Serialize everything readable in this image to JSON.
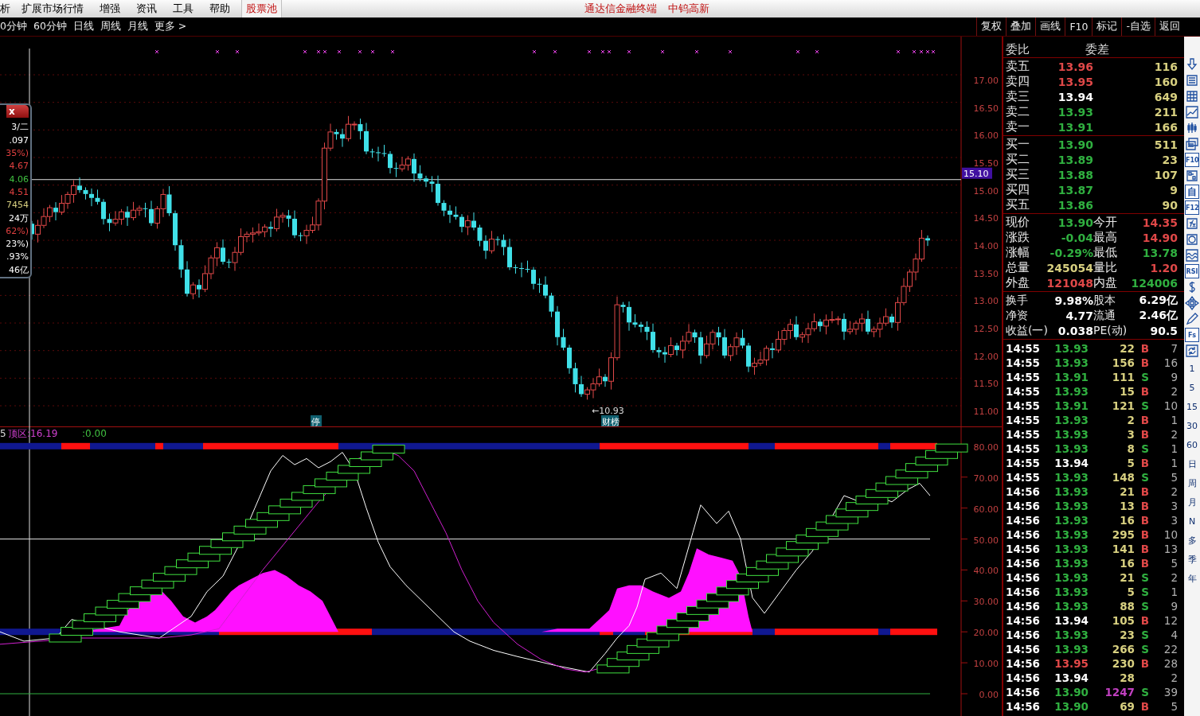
{
  "menu": [
    {
      "label": "析",
      "selected": false
    },
    {
      "label": "扩展市场行情",
      "selected": false
    },
    {
      "label": "增强",
      "selected": false
    },
    {
      "label": "资讯",
      "selected": false
    },
    {
      "label": "工具",
      "selected": false
    },
    {
      "label": "帮助",
      "selected": false
    },
    {
      "label": "股票池",
      "selected": true
    }
  ],
  "title": {
    "app": "通达信金融终端",
    "stock": "中钨高新"
  },
  "periods": [
    "0分钟",
    "60分钟",
    "日线",
    "周线",
    "月线",
    "更多 >"
  ],
  "chart_tools": [
    "复权",
    "叠加",
    "画线",
    "F10",
    "标记",
    "-自选",
    "返回"
  ],
  "info_popup": {
    "close": "x",
    "lines": [
      {
        "text": "3/二",
        "color": "#ffffff"
      },
      {
        "text": ".097",
        "color": "#ffffff"
      },
      {
        "text": "35%)",
        "color": "#e04040"
      },
      {
        "text": "4.67",
        "color": "#e04040"
      },
      {
        "text": "4.06",
        "color": "#40c040"
      },
      {
        "text": "4.51",
        "color": "#e04040"
      },
      {
        "text": "7454",
        "color": "#d8d080"
      },
      {
        "text": "24万",
        "color": "#ffffff"
      },
      {
        "text": "62%)",
        "color": "#e04040"
      },
      {
        "text": "23%)",
        "color": "#ffffff"
      },
      {
        "text": ".93%",
        "color": "#ffffff"
      },
      {
        "text": "46亿",
        "color": "#ffffff"
      }
    ]
  },
  "price_chart": {
    "axis": [
      "17.00",
      "16.50",
      "16.00",
      "15.50",
      "15.00",
      "14.50",
      "14.00",
      "13.50",
      "13.00",
      "12.50",
      "12.00",
      "11.50",
      "11.00"
    ],
    "price_tag": "15.10",
    "low_label": "←10.93",
    "markers": [
      "停",
      "财榜"
    ]
  },
  "indicator": {
    "prefix": "5",
    "label": "顶区:16.19",
    "value": ":0.00",
    "axis": [
      "80.00",
      "70.00",
      "60.00",
      "50.00",
      "40.00",
      "30.00",
      "20.00",
      "10.00",
      "0.00"
    ]
  },
  "order_book": {
    "header": [
      "委比",
      "委差"
    ],
    "asks": [
      {
        "label": "卖五",
        "price": "13.96",
        "volume": "116",
        "color": "#e04848"
      },
      {
        "label": "卖四",
        "price": "13.95",
        "volume": "160",
        "color": "#e04848"
      },
      {
        "label": "卖三",
        "price": "13.94",
        "volume": "649",
        "color": "#ffffff"
      },
      {
        "label": "卖二",
        "price": "13.93",
        "volume": "211",
        "color": "#30b040"
      },
      {
        "label": "卖一",
        "price": "13.91",
        "volume": "166",
        "color": "#30b040"
      }
    ],
    "bids": [
      {
        "label": "买一",
        "price": "13.90",
        "volume": "511",
        "color": "#30b040"
      },
      {
        "label": "买二",
        "price": "13.89",
        "volume": "23",
        "color": "#30b040"
      },
      {
        "label": "买三",
        "price": "13.88",
        "volume": "107",
        "color": "#30b040"
      },
      {
        "label": "买四",
        "price": "13.87",
        "volume": "9",
        "color": "#30b040"
      },
      {
        "label": "买五",
        "price": "13.86",
        "volume": "90",
        "color": "#30b040"
      }
    ],
    "quote": [
      {
        "label": "现价",
        "value": {
          "text": "13.90",
          "color": "#30b040"
        },
        "label2": "今开",
        "value2": {
          "text": "14.35",
          "color": "#e04848"
        }
      },
      {
        "label": "涨跌",
        "value": {
          "text": "-0.04",
          "color": "#30b040"
        },
        "label2": "最高",
        "value2": {
          "text": "14.90",
          "color": "#e04848"
        }
      },
      {
        "label": "涨幅",
        "value": {
          "text": "-0.29%",
          "color": "#30b040"
        },
        "label2": "最低",
        "value2": {
          "text": "13.78",
          "color": "#30b040"
        }
      },
      {
        "label": "总量",
        "value": {
          "text": "245054",
          "color": "#d8d080"
        },
        "label2": "量比",
        "value2": {
          "text": "1.20",
          "color": "#e04848"
        }
      },
      {
        "label": "外盘",
        "value": {
          "text": "121048",
          "color": "#e04848"
        },
        "label2": "内盘",
        "value2": {
          "text": "124006",
          "color": "#30b040"
        }
      }
    ],
    "finance": [
      {
        "label": "换手",
        "value": "9.98%",
        "label2": "股本",
        "value2": "6.29亿"
      },
      {
        "label": "净资",
        "value": "4.77",
        "label2": "流通",
        "value2": "2.46亿"
      },
      {
        "label": "收益(一)",
        "value": "0.038",
        "label2": "PE(动)",
        "value2": "90.5"
      }
    ]
  },
  "trades": [
    {
      "time": "14:55",
      "price": {
        "text": "13.93",
        "color": "#30b040"
      },
      "volume": {
        "text": "22",
        "color": "#d8d080"
      },
      "side": {
        "text": "B",
        "color": "#e04848"
      },
      "count": "7"
    },
    {
      "time": "14:55",
      "price": {
        "text": "13.93",
        "color": "#30b040"
      },
      "volume": {
        "text": "156",
        "color": "#d8d080"
      },
      "side": {
        "text": "B",
        "color": "#e04848"
      },
      "count": "16"
    },
    {
      "time": "14:55",
      "price": {
        "text": "13.91",
        "color": "#30b040"
      },
      "volume": {
        "text": "111",
        "color": "#d8d080"
      },
      "side": {
        "text": "S",
        "color": "#30b040"
      },
      "count": "9"
    },
    {
      "time": "14:55",
      "price": {
        "text": "13.93",
        "color": "#30b040"
      },
      "volume": {
        "text": "15",
        "color": "#d8d080"
      },
      "side": {
        "text": "B",
        "color": "#e04848"
      },
      "count": "2"
    },
    {
      "time": "14:55",
      "price": {
        "text": "13.91",
        "color": "#30b040"
      },
      "volume": {
        "text": "121",
        "color": "#d8d080"
      },
      "side": {
        "text": "S",
        "color": "#30b040"
      },
      "count": "10"
    },
    {
      "time": "14:55",
      "price": {
        "text": "13.93",
        "color": "#30b040"
      },
      "volume": {
        "text": "2",
        "color": "#d8d080"
      },
      "side": {
        "text": "B",
        "color": "#e04848"
      },
      "count": "1"
    },
    {
      "time": "14:55",
      "price": {
        "text": "13.93",
        "color": "#30b040"
      },
      "volume": {
        "text": "3",
        "color": "#d8d080"
      },
      "side": {
        "text": "B",
        "color": "#e04848"
      },
      "count": "2"
    },
    {
      "time": "14:55",
      "price": {
        "text": "13.93",
        "color": "#30b040"
      },
      "volume": {
        "text": "8",
        "color": "#d8d080"
      },
      "side": {
        "text": "S",
        "color": "#30b040"
      },
      "count": "1"
    },
    {
      "time": "14:55",
      "price": {
        "text": "13.94",
        "color": "#ffffff"
      },
      "volume": {
        "text": "5",
        "color": "#d8d080"
      },
      "side": {
        "text": "B",
        "color": "#e04848"
      },
      "count": "1"
    },
    {
      "time": "14:55",
      "price": {
        "text": "13.93",
        "color": "#30b040"
      },
      "volume": {
        "text": "148",
        "color": "#d8d080"
      },
      "side": {
        "text": "S",
        "color": "#30b040"
      },
      "count": "5"
    },
    {
      "time": "14:56",
      "price": {
        "text": "13.93",
        "color": "#30b040"
      },
      "volume": {
        "text": "21",
        "color": "#d8d080"
      },
      "side": {
        "text": "B",
        "color": "#e04848"
      },
      "count": "2"
    },
    {
      "time": "14:56",
      "price": {
        "text": "13.93",
        "color": "#30b040"
      },
      "volume": {
        "text": "13",
        "color": "#d8d080"
      },
      "side": {
        "text": "B",
        "color": "#e04848"
      },
      "count": "3"
    },
    {
      "time": "14:56",
      "price": {
        "text": "13.93",
        "color": "#30b040"
      },
      "volume": {
        "text": "16",
        "color": "#d8d080"
      },
      "side": {
        "text": "B",
        "color": "#e04848"
      },
      "count": "3"
    },
    {
      "time": "14:56",
      "price": {
        "text": "13.93",
        "color": "#30b040"
      },
      "volume": {
        "text": "295",
        "color": "#d8d080"
      },
      "side": {
        "text": "B",
        "color": "#e04848"
      },
      "count": "10"
    },
    {
      "time": "14:56",
      "price": {
        "text": "13.93",
        "color": "#30b040"
      },
      "volume": {
        "text": "141",
        "color": "#d8d080"
      },
      "side": {
        "text": "B",
        "color": "#e04848"
      },
      "count": "13"
    },
    {
      "time": "14:56",
      "price": {
        "text": "13.93",
        "color": "#30b040"
      },
      "volume": {
        "text": "16",
        "color": "#d8d080"
      },
      "side": {
        "text": "B",
        "color": "#e04848"
      },
      "count": "5"
    },
    {
      "time": "14:56",
      "price": {
        "text": "13.93",
        "color": "#30b040"
      },
      "volume": {
        "text": "21",
        "color": "#d8d080"
      },
      "side": {
        "text": "S",
        "color": "#30b040"
      },
      "count": "2"
    },
    {
      "time": "14:56",
      "price": {
        "text": "13.93",
        "color": "#30b040"
      },
      "volume": {
        "text": "5",
        "color": "#d8d080"
      },
      "side": {
        "text": "S",
        "color": "#30b040"
      },
      "count": "1"
    },
    {
      "time": "14:56",
      "price": {
        "text": "13.93",
        "color": "#30b040"
      },
      "volume": {
        "text": "88",
        "color": "#d8d080"
      },
      "side": {
        "text": "S",
        "color": "#30b040"
      },
      "count": "9"
    },
    {
      "time": "14:56",
      "price": {
        "text": "13.94",
        "color": "#ffffff"
      },
      "volume": {
        "text": "105",
        "color": "#d8d080"
      },
      "side": {
        "text": "B",
        "color": "#e04848"
      },
      "count": "12"
    },
    {
      "time": "14:56",
      "price": {
        "text": "13.93",
        "color": "#30b040"
      },
      "volume": {
        "text": "23",
        "color": "#d8d080"
      },
      "side": {
        "text": "S",
        "color": "#30b040"
      },
      "count": "4"
    },
    {
      "time": "14:56",
      "price": {
        "text": "13.93",
        "color": "#30b040"
      },
      "volume": {
        "text": "266",
        "color": "#d8d080"
      },
      "side": {
        "text": "S",
        "color": "#30b040"
      },
      "count": "22"
    },
    {
      "time": "14:56",
      "price": {
        "text": "13.95",
        "color": "#e04848"
      },
      "volume": {
        "text": "230",
        "color": "#d8d080"
      },
      "side": {
        "text": "B",
        "color": "#e04848"
      },
      "count": "28"
    },
    {
      "time": "14:56",
      "price": {
        "text": "13.94",
        "color": "#ffffff"
      },
      "volume": {
        "text": "28",
        "color": "#d8d080"
      },
      "count": "2"
    },
    {
      "time": "14:56",
      "price": {
        "text": "13.90",
        "color": "#30b040"
      },
      "volume": {
        "text": "1247",
        "color": "#c040c0"
      },
      "side": {
        "text": "S",
        "color": "#30b040"
      },
      "count": "39"
    },
    {
      "time": "14:56",
      "price": {
        "text": "13.90",
        "color": "#30b040"
      },
      "volume": {
        "text": "69",
        "color": "#d8d080"
      },
      "side": {
        "text": "B",
        "color": "#e04848"
      },
      "count": "5"
    }
  ],
  "side_toolbar": [
    {
      "kind": "arrow-down"
    },
    {
      "kind": "list"
    },
    {
      "kind": "table"
    },
    {
      "kind": "line-chart"
    },
    {
      "kind": "candles"
    },
    {
      "kind": "windows"
    },
    {
      "kind": "text",
      "label": "F10"
    },
    {
      "kind": "tree"
    },
    {
      "kind": "text",
      "label": "自"
    },
    {
      "kind": "text",
      "label": "F12"
    },
    {
      "kind": "fx"
    },
    {
      "kind": "circle"
    },
    {
      "kind": "wave"
    },
    {
      "kind": "text",
      "label": "RSI"
    },
    {
      "kind": "dollar"
    },
    {
      "kind": "move"
    },
    {
      "kind": "pencil"
    },
    {
      "kind": "text",
      "label": "Fs"
    },
    {
      "kind": "refresh"
    }
  ],
  "side_periods": [
    "1",
    "5",
    "15",
    "30",
    "60",
    "日",
    "周",
    "月",
    "N",
    "多",
    "季",
    "年"
  ]
}
